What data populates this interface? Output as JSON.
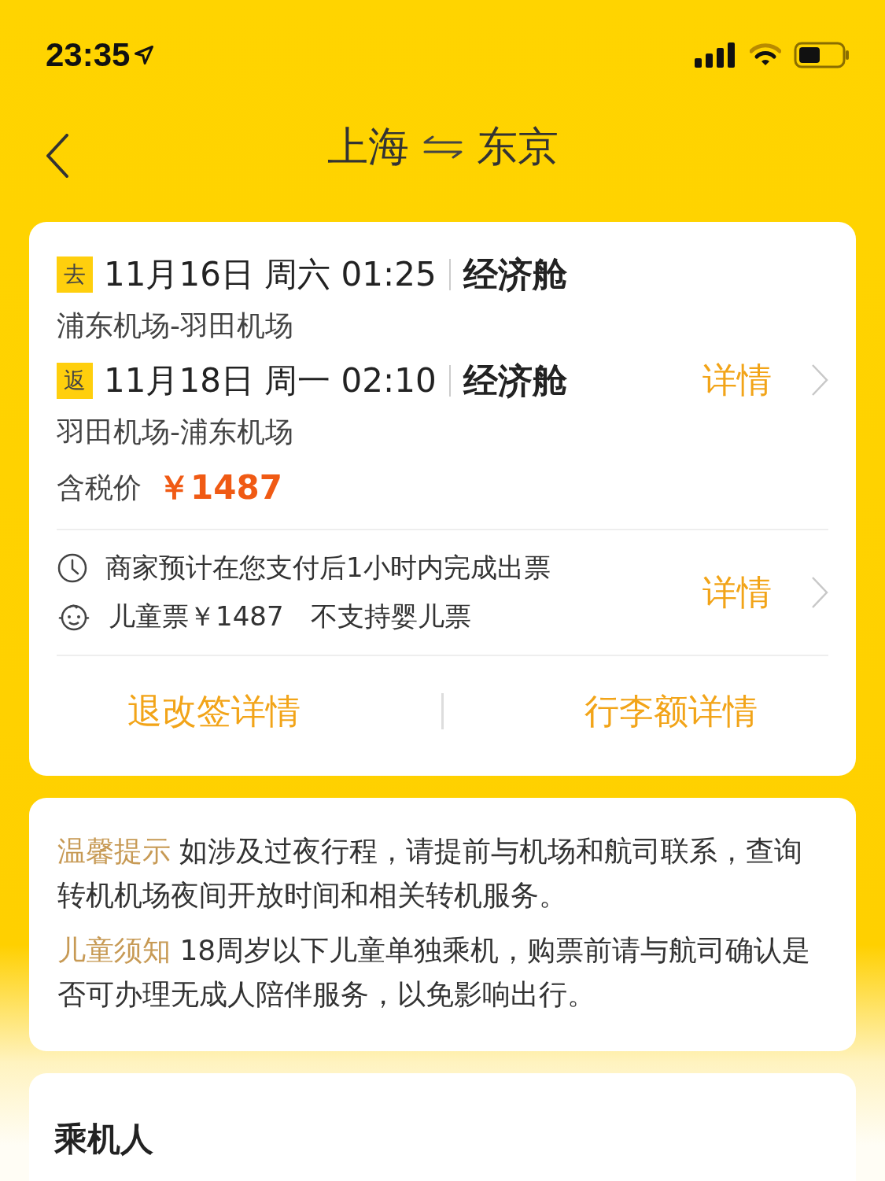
{
  "status_bar": {
    "time": "23:35"
  },
  "nav": {
    "from": "上海",
    "to": "东京"
  },
  "flight_card": {
    "segments": [
      {
        "tag": "去",
        "schedule": "11月16日 周六 01:25",
        "cabin": "经济舱",
        "route": "浦东机场-羽田机场"
      },
      {
        "tag": "返",
        "schedule": "11月18日 周一 02:10",
        "cabin": "经济舱",
        "route": "羽田机场-浦东机场"
      }
    ],
    "price_label": "含税价",
    "price": "￥1487",
    "detail_link": "详情"
  },
  "ticket_info": {
    "items": [
      {
        "kind": "clock",
        "texts": [
          "商家预计在您支付后1小时内完成出票"
        ]
      },
      {
        "kind": "child",
        "texts": [
          "儿童票￥1487",
          "不支持婴儿票"
        ]
      }
    ],
    "detail_link": "详情"
  },
  "actions": [
    "退改签详情",
    "行李额详情"
  ],
  "notices": [
    {
      "title": "温馨提示",
      "body": "如涉及过夜行程，请提前与机场和航司联系，查询转机机场夜间开放时间和相关转机服务。"
    },
    {
      "title": "儿童须知",
      "body": "18周岁以下儿童单独乘机，购票前请与航司确认是否可办理无成人陪伴服务，以免影响出行。"
    }
  ],
  "passengers": {
    "title": "乘机人"
  }
}
